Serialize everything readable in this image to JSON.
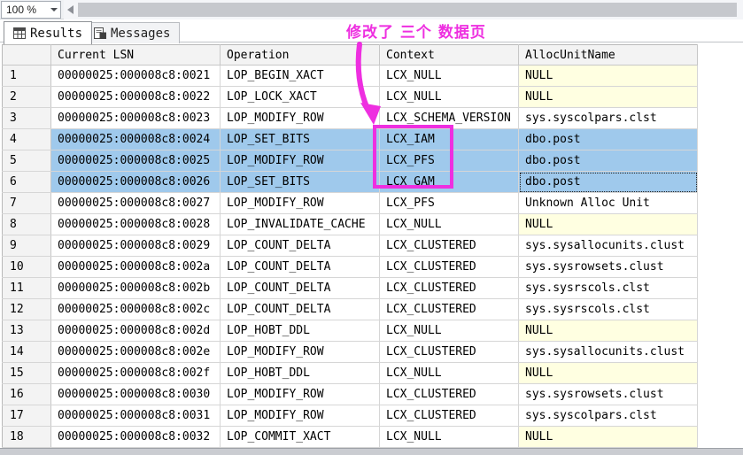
{
  "toolbar": {
    "zoom_value": "100 %"
  },
  "tabs": [
    {
      "label": "Results"
    },
    {
      "label": "Messages"
    }
  ],
  "annotation": {
    "text": "修改了 三个 数据页",
    "color": "#ee2fe0"
  },
  "grid": {
    "columns": [
      "",
      "Current LSN",
      "Operation",
      "Context",
      "AllocUnitName"
    ],
    "colors": {
      "selection": "#9fc9ec",
      "null_cell": "#ffffe1"
    },
    "rows": [
      {
        "num": "1",
        "lsn": "00000025:000008c8:0021",
        "operation": "LOP_BEGIN_XACT",
        "context": "LCX_NULL",
        "alloc_unit": "NULL",
        "selected": false,
        "focused": false
      },
      {
        "num": "2",
        "lsn": "00000025:000008c8:0022",
        "operation": "LOP_LOCK_XACT",
        "context": "LCX_NULL",
        "alloc_unit": "NULL",
        "selected": false,
        "focused": false
      },
      {
        "num": "3",
        "lsn": "00000025:000008c8:0023",
        "operation": "LOP_MODIFY_ROW",
        "context": "LCX_SCHEMA_VERSION",
        "alloc_unit": "sys.syscolpars.clst",
        "selected": false,
        "focused": false
      },
      {
        "num": "4",
        "lsn": "00000025:000008c8:0024",
        "operation": "LOP_SET_BITS",
        "context": "LCX_IAM",
        "alloc_unit": "dbo.post",
        "selected": true,
        "focused": false
      },
      {
        "num": "5",
        "lsn": "00000025:000008c8:0025",
        "operation": "LOP_MODIFY_ROW",
        "context": "LCX_PFS",
        "alloc_unit": "dbo.post",
        "selected": true,
        "focused": false
      },
      {
        "num": "6",
        "lsn": "00000025:000008c8:0026",
        "operation": "LOP_SET_BITS",
        "context": "LCX_GAM",
        "alloc_unit": "dbo.post",
        "selected": true,
        "focused": true
      },
      {
        "num": "7",
        "lsn": "00000025:000008c8:0027",
        "operation": "LOP_MODIFY_ROW",
        "context": "LCX_PFS",
        "alloc_unit": "Unknown Alloc Unit",
        "selected": false,
        "focused": false
      },
      {
        "num": "8",
        "lsn": "00000025:000008c8:0028",
        "operation": "LOP_INVALIDATE_CACHE",
        "context": "LCX_NULL",
        "alloc_unit": "NULL",
        "selected": false,
        "focused": false
      },
      {
        "num": "9",
        "lsn": "00000025:000008c8:0029",
        "operation": "LOP_COUNT_DELTA",
        "context": "LCX_CLUSTERED",
        "alloc_unit": "sys.sysallocunits.clust",
        "selected": false,
        "focused": false
      },
      {
        "num": "10",
        "lsn": "00000025:000008c8:002a",
        "operation": "LOP_COUNT_DELTA",
        "context": "LCX_CLUSTERED",
        "alloc_unit": "sys.sysrowsets.clust",
        "selected": false,
        "focused": false
      },
      {
        "num": "11",
        "lsn": "00000025:000008c8:002b",
        "operation": "LOP_COUNT_DELTA",
        "context": "LCX_CLUSTERED",
        "alloc_unit": "sys.sysrscols.clst",
        "selected": false,
        "focused": false
      },
      {
        "num": "12",
        "lsn": "00000025:000008c8:002c",
        "operation": "LOP_COUNT_DELTA",
        "context": "LCX_CLUSTERED",
        "alloc_unit": "sys.sysrscols.clst",
        "selected": false,
        "focused": false
      },
      {
        "num": "13",
        "lsn": "00000025:000008c8:002d",
        "operation": "LOP_HOBT_DDL",
        "context": "LCX_NULL",
        "alloc_unit": "NULL",
        "selected": false,
        "focused": false
      },
      {
        "num": "14",
        "lsn": "00000025:000008c8:002e",
        "operation": "LOP_MODIFY_ROW",
        "context": "LCX_CLUSTERED",
        "alloc_unit": "sys.sysallocunits.clust",
        "selected": false,
        "focused": false
      },
      {
        "num": "15",
        "lsn": "00000025:000008c8:002f",
        "operation": "LOP_HOBT_DDL",
        "context": "LCX_NULL",
        "alloc_unit": "NULL",
        "selected": false,
        "focused": false
      },
      {
        "num": "16",
        "lsn": "00000025:000008c8:0030",
        "operation": "LOP_MODIFY_ROW",
        "context": "LCX_CLUSTERED",
        "alloc_unit": "sys.sysrowsets.clust",
        "selected": false,
        "focused": false
      },
      {
        "num": "17",
        "lsn": "00000025:000008c8:0031",
        "operation": "LOP_MODIFY_ROW",
        "context": "LCX_CLUSTERED",
        "alloc_unit": "sys.syscolpars.clst",
        "selected": false,
        "focused": false
      },
      {
        "num": "18",
        "lsn": "00000025:000008c8:0032",
        "operation": "LOP_COMMIT_XACT",
        "context": "LCX_NULL",
        "alloc_unit": "NULL",
        "selected": false,
        "focused": false
      }
    ]
  }
}
